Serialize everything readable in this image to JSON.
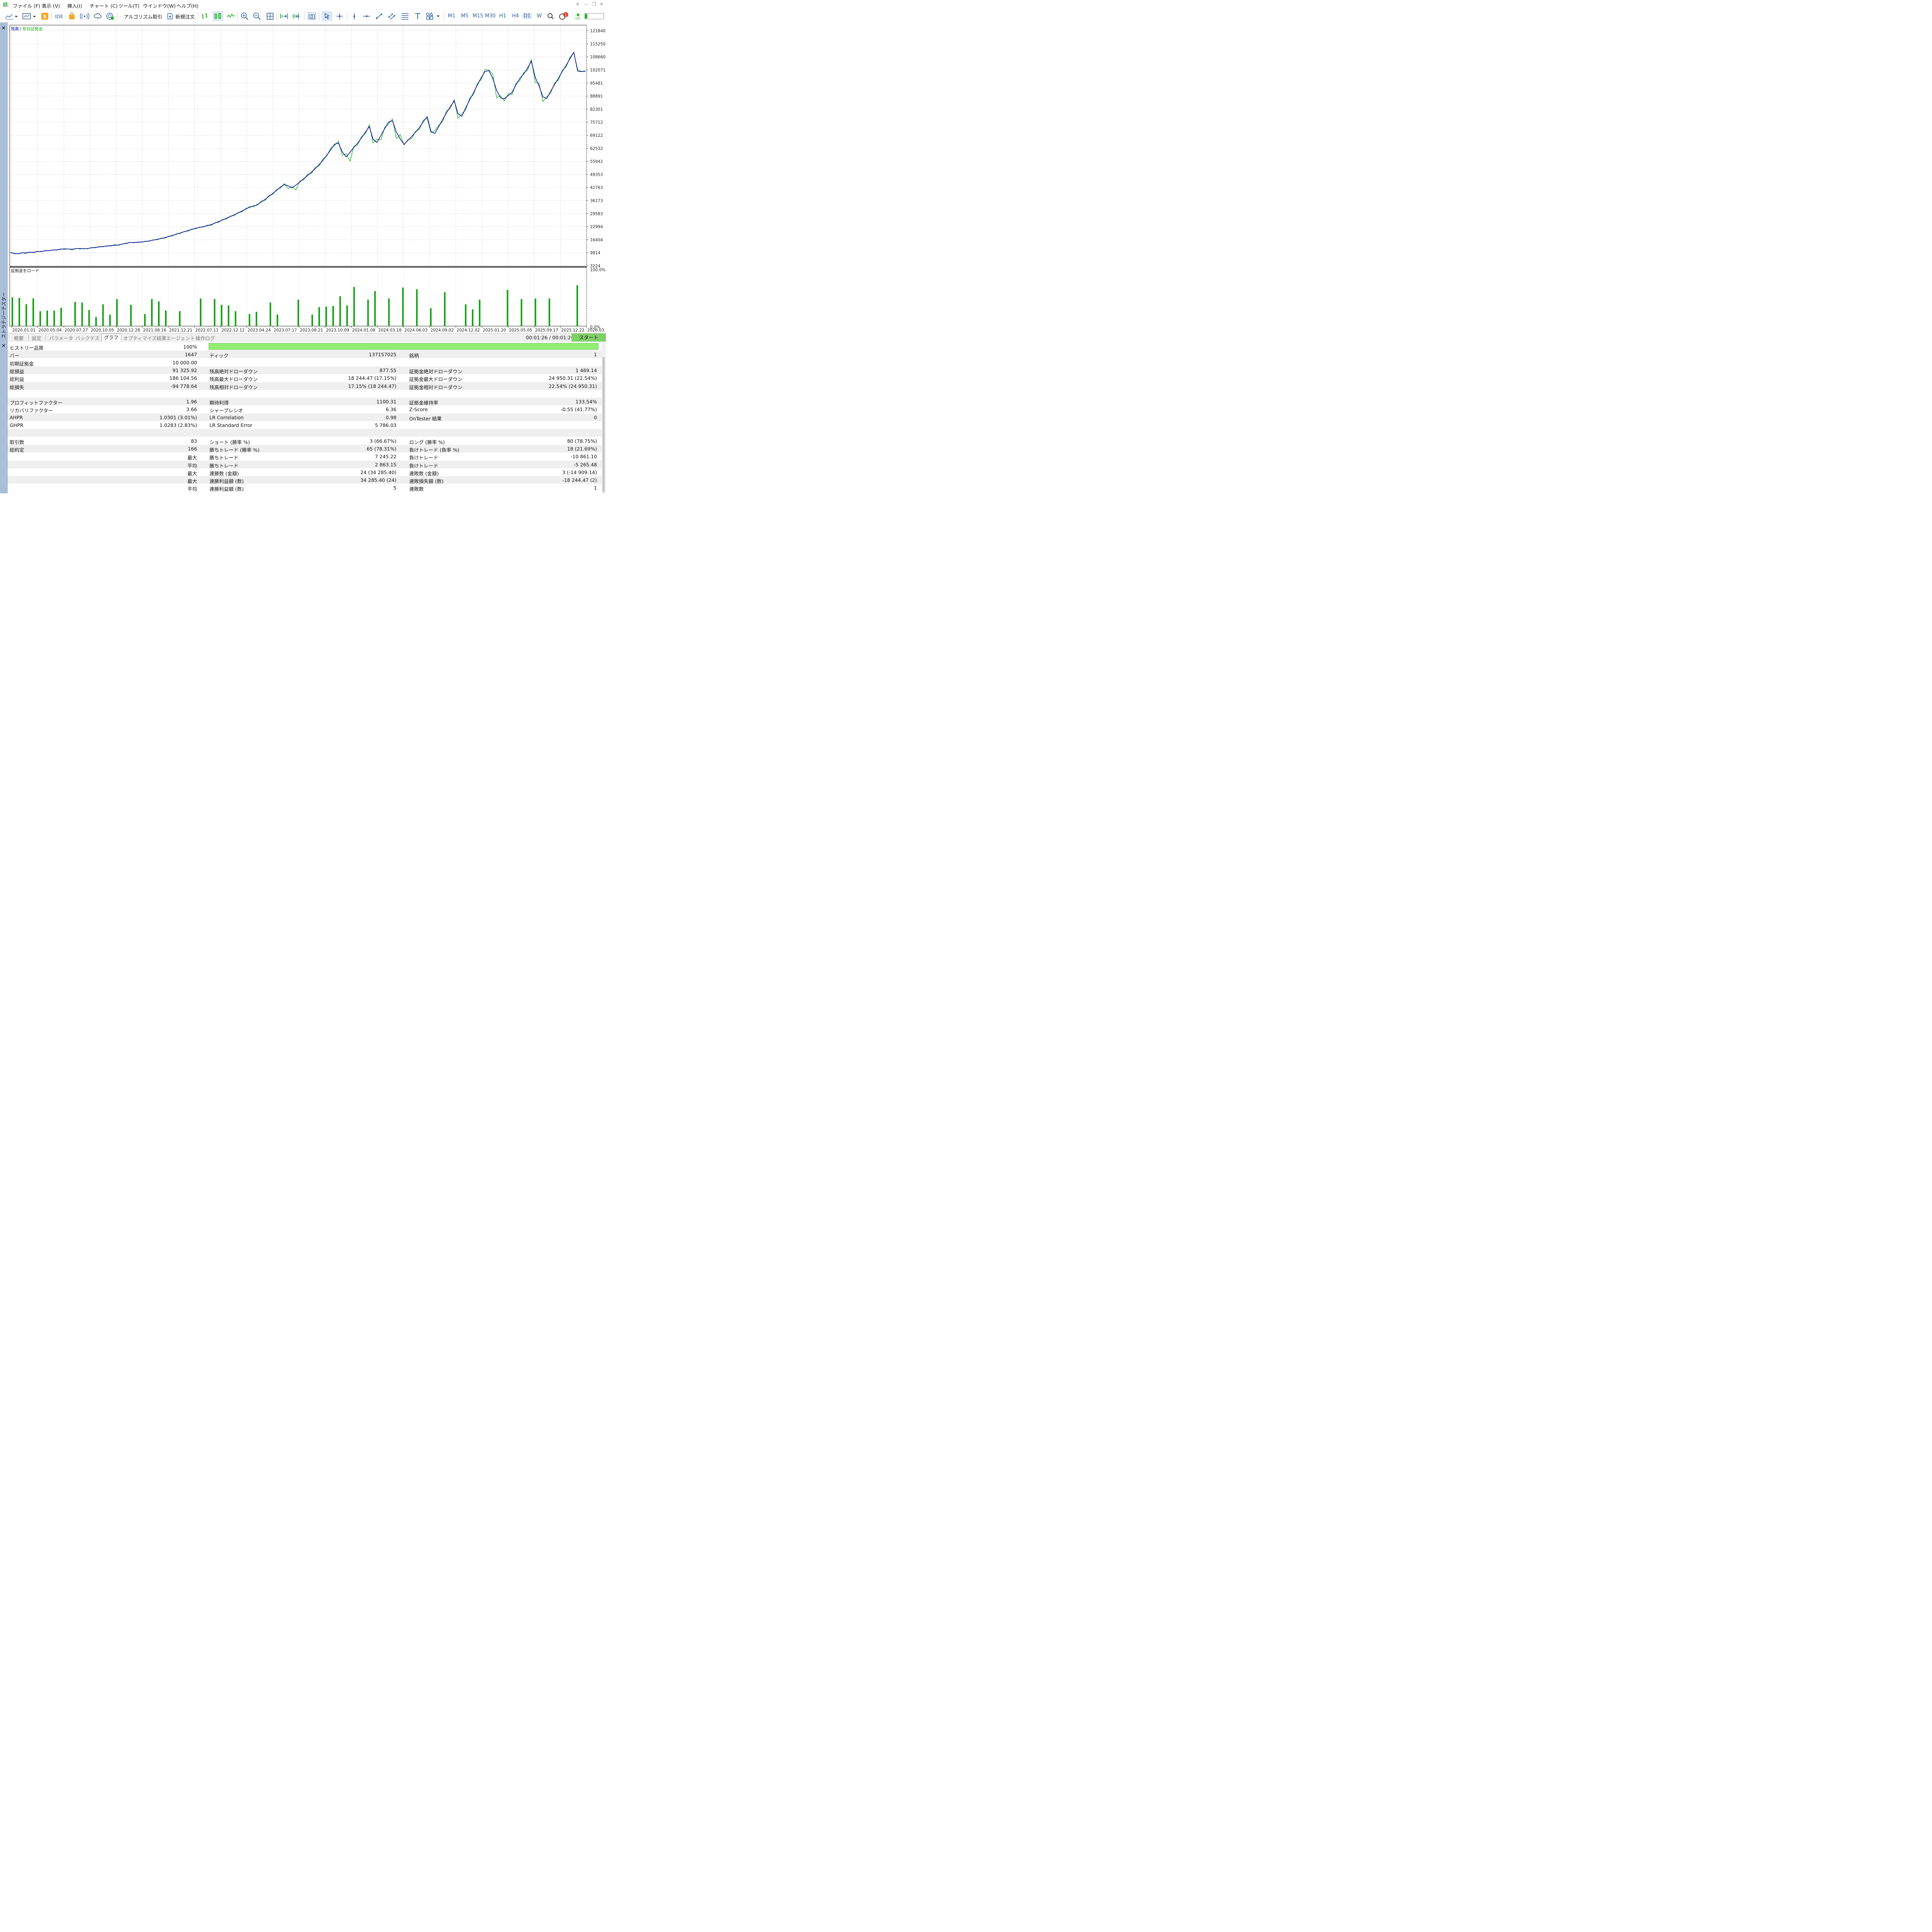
{
  "menu": {
    "file": "ファイル (F)",
    "view": "表示 (V)",
    "insert": "挿入(I)",
    "chart": "チャート (C)",
    "tools": "ツール(T)",
    "window": "ウインドウ(W)",
    "help": "ヘルプ(H)"
  },
  "toolbar": {
    "ide": "IDE",
    "algo_trading": "アルゴリズム取引",
    "new_order": "新規注文",
    "timeframes": [
      "M1",
      "M5",
      "M15",
      "M30",
      "H1",
      "H4",
      "D1",
      "W"
    ],
    "active_timeframe": "D1",
    "notification_count": "1",
    "lvl_label": "LVL"
  },
  "panel": {
    "vertical_title": "ストラテジーテスター"
  },
  "chart": {
    "legend_balance": "残高",
    "legend_sep": "/",
    "legend_equity": "有効証拠金",
    "sub_title": "証拠金をロード",
    "sub_top": "100.0%",
    "sub_bottom": "0.0%",
    "balance_color": "#0000a8",
    "equity_color": "#1cb41c",
    "load_color": "#10a010"
  },
  "chart_data": {
    "type": "line",
    "title": "",
    "y_ticks": [
      3224,
      9814,
      16404,
      22994,
      29583,
      36173,
      42763,
      49353,
      55942,
      62532,
      69122,
      75712,
      82301,
      88891,
      95481,
      102071,
      108660,
      115250,
      121840
    ],
    "ylim": [
      3224,
      124500
    ],
    "x_ticks": [
      "2020.01.01",
      "2020.05.04",
      "2020.07.27",
      "2020.10.05",
      "2020.12.28",
      "2021.08.16",
      "2021.12.21",
      "2022.07.11",
      "2022.12.12",
      "2023.04.24",
      "2023.07.17",
      "2023.08.21",
      "2023.10.09",
      "2024.01.08",
      "2024.03.18",
      "2024.06.03",
      "2024.09.02",
      "2024.12.02",
      "2025.01.20",
      "2025.05.05",
      "2025.09.17",
      "2025.12.22",
      "2026.03.16"
    ],
    "n_points": 150,
    "series": [
      {
        "name": "残高",
        "values": [
          9900,
          9500,
          9300,
          9800,
          9800,
          10100,
          10000,
          10400,
          10500,
          10800,
          10900,
          11200,
          11300,
          11600,
          11800,
          11700,
          11600,
          11900,
          12000,
          11800,
          12000,
          12300,
          12500,
          12800,
          13000,
          13200,
          13400,
          13600,
          13800,
          14200,
          14600,
          15000,
          15000,
          15100,
          15300,
          15500,
          15800,
          16200,
          16600,
          17000,
          17400,
          18000,
          18600,
          19200,
          19800,
          20400,
          21000,
          21600,
          22200,
          22600,
          23000,
          23500,
          24000,
          24800,
          25600,
          26400,
          27200,
          28100,
          29000,
          29900,
          30900,
          31900,
          33000,
          33200,
          34200,
          35400,
          36800,
          38300,
          39800,
          41300,
          43000,
          44200,
          43600,
          42600,
          44000,
          45500,
          47200,
          48800,
          50500,
          52300,
          54300,
          56500,
          59100,
          61800,
          64600,
          65200,
          60700,
          58200,
          60500,
          63000,
          65200,
          67900,
          70700,
          73500,
          67000,
          65500,
          69000,
          72500,
          75800,
          76400,
          70800,
          67300,
          64500,
          66500,
          68500,
          70700,
          73000,
          76000,
          78500,
          71000,
          70000,
          73500,
          77000,
          80500,
          83600,
          86400,
          80000,
          78700,
          83000,
          87000,
          90500,
          94500,
          98200,
          101300,
          101700,
          97800,
          91800,
          88000,
          87500,
          89200,
          90800,
          94500,
          97800,
          100000,
          103000,
          106500,
          98300,
          94000,
          88500,
          87700,
          91300,
          94700,
          97800,
          101300,
          104300,
          107800,
          111000,
          101500,
          101200,
          101400
        ],
        "color": "#0000a8"
      },
      {
        "name": "有効証拠金",
        "values": [
          10100,
          9300,
          9400,
          9900,
          9500,
          10200,
          9800,
          10600,
          10300,
          11000,
          10800,
          11300,
          11100,
          11800,
          11500,
          11800,
          11200,
          12100,
          11700,
          12000,
          11800,
          12500,
          12300,
          13000,
          12800,
          13400,
          13200,
          13900,
          13600,
          14300,
          14400,
          15100,
          14800,
          15300,
          15100,
          15700,
          15600,
          16400,
          16300,
          17200,
          17100,
          18200,
          18300,
          19400,
          19500,
          20600,
          20700,
          21800,
          21900,
          22800,
          22700,
          23800,
          23600,
          25000,
          25200,
          26700,
          26800,
          28400,
          28500,
          30200,
          30400,
          32200,
          32600,
          33600,
          33800,
          35900,
          36300,
          38800,
          39300,
          41800,
          42500,
          44800,
          42200,
          43200,
          41500,
          46100,
          46600,
          49500,
          49800,
          52900,
          53600,
          57300,
          58700,
          62600,
          63900,
          66200,
          58900,
          59800,
          56000,
          63600,
          64300,
          68500,
          69800,
          74500,
          65200,
          67200,
          66800,
          73100,
          74800,
          77400,
          67400,
          69500,
          64200,
          66900,
          67400,
          71200,
          72000,
          76800,
          77600,
          70400,
          71500,
          74100,
          76000,
          81300,
          82700,
          87200,
          77600,
          80100,
          82000,
          87900,
          89600,
          95200,
          97200,
          102300,
          102000,
          100100,
          88000,
          89100,
          86400,
          90000,
          89700,
          95300,
          96600,
          100700,
          101900,
          107400,
          95800,
          95300,
          86100,
          88600,
          90400,
          95500,
          96900,
          101900,
          103500,
          108500,
          110800,
          102200,
          101300,
          101600
        ],
        "color": "#1cb41c"
      }
    ],
    "load_bars": [
      50,
      49,
      38,
      48,
      26,
      27,
      27,
      32,
      0,
      42,
      41,
      28,
      16,
      38,
      20,
      47,
      0,
      37,
      0,
      21,
      47,
      43,
      27,
      0,
      26,
      0,
      0,
      48,
      0,
      47,
      37,
      36,
      26,
      0,
      21,
      25,
      0,
      41,
      20,
      0,
      0,
      46,
      0,
      20,
      33,
      34,
      35,
      52,
      36,
      68,
      0,
      46,
      61,
      0,
      48,
      0,
      67,
      0,
      64,
      0,
      31,
      0,
      59,
      0,
      0,
      38,
      29,
      46,
      0,
      0,
      0,
      63,
      0,
      47,
      0,
      48,
      0,
      48,
      0,
      0,
      0,
      71,
      0
    ],
    "legend": "top-left",
    "grid": true
  },
  "tabs": [
    "概要",
    "設定",
    "パラメータ",
    "バックテスト",
    "グラフ",
    "オプティマイズ結果",
    "エージェント",
    "操作ログ"
  ],
  "active_tab": "グラフ",
  "timer": "00:01:26 / 00:01:26",
  "start_button": "スタート",
  "results": {
    "rows": [
      {
        "c1l": "ヒストリー品質",
        "c1v": "100%",
        "c2l": "",
        "c2v": "",
        "c3l": "",
        "c3v": ""
      },
      {
        "c1l": "バー",
        "c1v": "1647",
        "c2l": "ティック",
        "c2v": "137157025",
        "c3l": "銘柄",
        "c3v": "1"
      },
      {
        "c1l": "初期証拠金",
        "c1v": "10 000.00",
        "c2l": "",
        "c2v": "",
        "c3l": "",
        "c3v": ""
      },
      {
        "c1l": "総損益",
        "c1v": "91 325.92",
        "c2l": "残高絶対ドローダウン",
        "c2v": "877.55",
        "c3l": "証拠金絶対ドローダウン",
        "c3v": "1 469.14"
      },
      {
        "c1l": "総利益",
        "c1v": "186 104.56",
        "c2l": "残高最大ドローダウン",
        "c2v": "18 244.47 (17.15%)",
        "c3l": "証拠金最大ドローダウン",
        "c3v": "24 950.31 (22.54%)"
      },
      {
        "c1l": "総損失",
        "c1v": "-94 778.64",
        "c2l": "残高相対ドローダウン",
        "c2v": "17.15% (18 244.47)",
        "c3l": "証拠金相対ドローダウン",
        "c3v": "22.54% (24 950.31)"
      },
      {
        "c1l": "",
        "c1v": "",
        "c2l": "",
        "c2v": "",
        "c3l": "",
        "c3v": ""
      },
      {
        "c1l": "プロフィットファクター",
        "c1v": "1.96",
        "c2l": "期待利得",
        "c2v": "1100.31",
        "c3l": "証拠金維持率",
        "c3v": "133.54%"
      },
      {
        "c1l": "リカバリファクター",
        "c1v": "3.66",
        "c2l": "シャープレシオ",
        "c2v": "6.36",
        "c3l": "Z-Score",
        "c3v": "-0.55 (41.77%)"
      },
      {
        "c1l": "AHPR",
        "c1v": "1.0301 (3.01%)",
        "c2l": "LR Correlation",
        "c2v": "0.98",
        "c3l": "OnTester 結果",
        "c3v": "0"
      },
      {
        "c1l": "GHPR",
        "c1v": "1.0283 (2.83%)",
        "c2l": "LR Standard Error",
        "c2v": "5 786.03",
        "c3l": "",
        "c3v": ""
      },
      {
        "c1l": "",
        "c1v": "",
        "c2l": "",
        "c2v": "",
        "c3l": "",
        "c3v": ""
      },
      {
        "c1l": "取引数",
        "c1v": "83",
        "c2l": "ショート (勝率 %)",
        "c2v": "3 (66.67%)",
        "c3l": "ロング (勝率 %)",
        "c3v": "80 (78.75%)"
      },
      {
        "c1l": "総約定",
        "c1v": "166",
        "c2l": "勝ちトレード (勝率 %)",
        "c2v": "65 (78.31%)",
        "c3l": "負けトレード (負率 %)",
        "c3v": "18 (21.69%)"
      },
      {
        "c1l": "",
        "c1v": "最大",
        "c2l": "勝ちトレード",
        "c2v": "7 245.22",
        "c3l": "負けトレード",
        "c3v": "-10 861.10"
      },
      {
        "c1l": "",
        "c1v": "平均",
        "c2l": "勝ちトレード",
        "c2v": "2 863.15",
        "c3l": "負けトレード",
        "c3v": "-5 265.48"
      },
      {
        "c1l": "",
        "c1v": "最大",
        "c2l": "連勝数 (金額)",
        "c2v": "24 (34 285.40)",
        "c3l": "連敗数 (金額)",
        "c3v": "3 (-14 909.14)"
      },
      {
        "c1l": "",
        "c1v": "最大",
        "c2l": "連勝利益額 (数)",
        "c2v": "34 285.40 (24)",
        "c3l": "連敗損失額 (数)",
        "c3v": "-18 244.47 (2)"
      },
      {
        "c1l": "",
        "c1v": "平均",
        "c2l": "連勝利益額 (数)",
        "c2v": "5",
        "c3l": "連敗数",
        "c3v": "1"
      }
    ]
  }
}
